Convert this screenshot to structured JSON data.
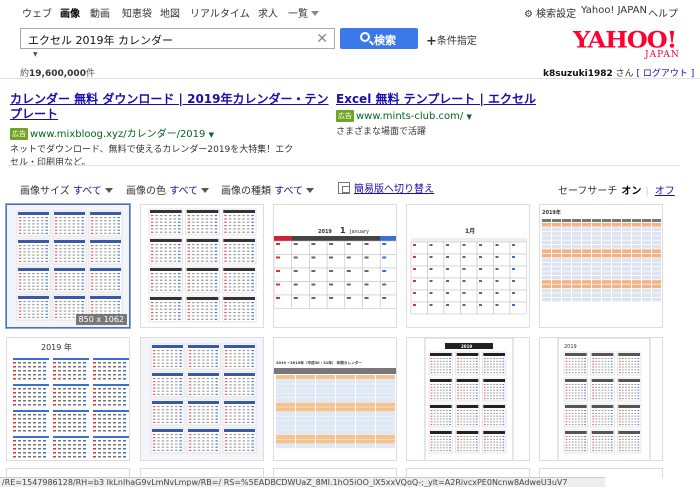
{
  "nav": {
    "tabs": [
      {
        "label": "ウェブ",
        "active": false
      },
      {
        "label": "画像",
        "active": true
      },
      {
        "label": "動画",
        "active": false
      },
      {
        "label": "知恵袋",
        "active": false
      },
      {
        "label": "地図",
        "active": false
      },
      {
        "label": "リアルタイム",
        "active": false
      },
      {
        "label": "求人",
        "active": false
      },
      {
        "label": "一覧",
        "active": false
      }
    ],
    "settings": "検索設定",
    "yahoo_japan": "Yahoo! JAPAN",
    "help": "ヘルプ"
  },
  "search": {
    "query": "エクセル 2019年 カレンダー",
    "button": "検索",
    "advanced": "条件指定"
  },
  "logo": {
    "main": "YAHOO!",
    "sub": "JAPAN"
  },
  "results": {
    "count_prefix": "約",
    "count": "19,600,000",
    "count_suffix": "件"
  },
  "user": {
    "name": "k8suzuki1982",
    "suffix": " さん",
    "logout": "[ ログアウト ]"
  },
  "ads": [
    {
      "title_line1": "カレンダー 無料 ダウンロード | 2019年カレンダー・テン",
      "title_line2": "プレート",
      "badge": "広告",
      "url": "www.mixbloog.xyz/カレンダー/2019",
      "desc_line1": "ネットでダウンロード、無料で使えるカレンダー2019を大特集！エク",
      "desc_line2": "セル・印刷用など。"
    },
    {
      "title_line1": "Excel 無料 テンプレート | エクセル",
      "badge": "広告",
      "url": "www.mints-club.com/",
      "desc_line1": "さまざまな場面で活躍"
    }
  ],
  "filters": {
    "size_label": "画像サイズ",
    "size_value": "すべて",
    "color_label": "画像の色",
    "color_value": "すべて",
    "type_label": "画像の種類",
    "type_value": "すべて",
    "easy_switch": "簡易版へ切り替え",
    "safe_label": "セーフサーチ",
    "safe_on": "オン",
    "safe_off": "オフ"
  },
  "thumbnails": [
    {
      "kind": "year-grid-blue",
      "selected": true,
      "size": "850 x 1062"
    },
    {
      "kind": "year-grid-plain",
      "selected": false
    },
    {
      "kind": "month-table",
      "selected": false,
      "month_num": "1",
      "month_name": "January",
      "year": "2019"
    },
    {
      "kind": "month-table-jp",
      "selected": false,
      "month_num": "1月"
    },
    {
      "kind": "orange-grid",
      "selected": false,
      "year": "2019年"
    },
    {
      "kind": "year-text",
      "selected": false,
      "year": "2019 年"
    },
    {
      "kind": "year-grid-blue",
      "selected": false
    },
    {
      "kind": "orange-grid-wide",
      "selected": false,
      "caption": "2019 ~2019年（平成30・31年） 年間カレンダー"
    },
    {
      "kind": "year-grid-dark",
      "selected": false,
      "year": "2019"
    },
    {
      "kind": "year-grid-small",
      "selected": false,
      "year": "2019"
    }
  ],
  "status_url": "/RE=1547986128/RH=b3 lkLnlhaG9vLmNvLmpw/RB=/ RS=%5EADBCDWUaZ_8MI.1hO5iOO_lX5xxVQoQ-;_ylt=A2RivcxPE0Ncnw8AdweU3uV7"
}
